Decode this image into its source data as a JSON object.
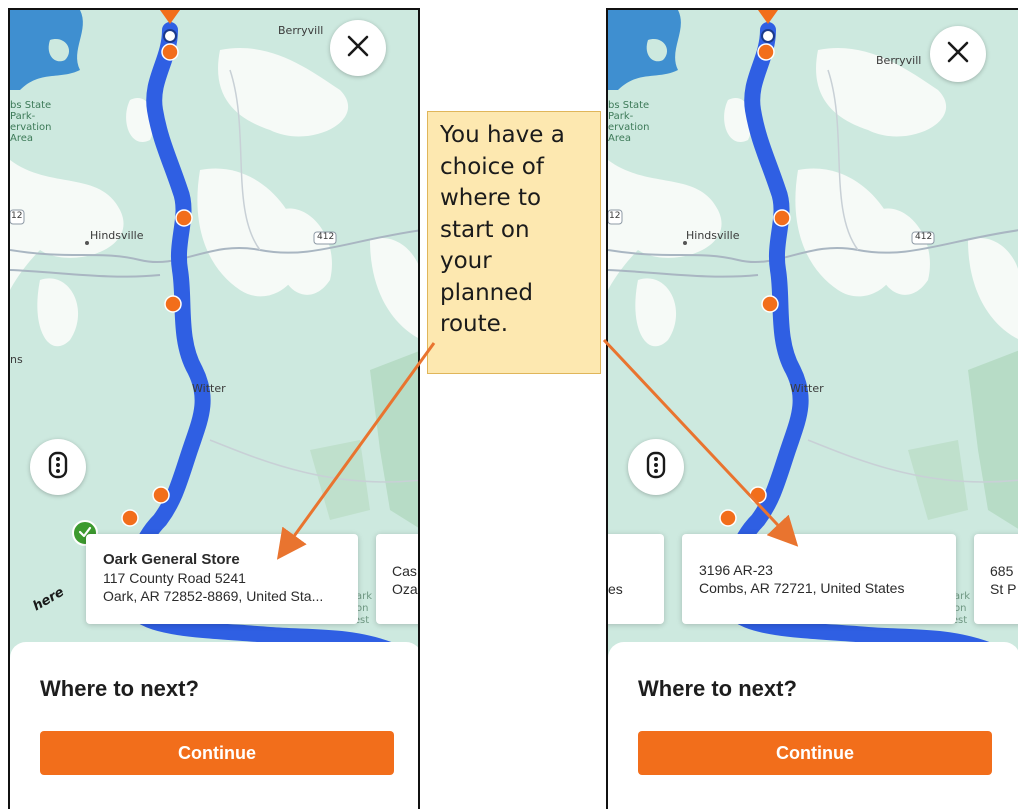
{
  "callout": {
    "text": "You have a choice of where to start on your planned route."
  },
  "left_phone": {
    "map_labels": {
      "berryville": "Berryvill",
      "park": "bs State Park- ervation Area",
      "hindsville": "Hindsville",
      "witter": "Witter",
      "hwy_412": "412",
      "hwy_12": "12",
      "ns": "ns",
      "ark": "ark",
      "on": "on",
      "rest": "rest"
    },
    "selected_card": {
      "name": "Oark General Store",
      "line1": "117 County Road 5241",
      "line2": "Oark, AR 72852-8869, United Sta..."
    },
    "next_card": {
      "line1": "Cas",
      "line2": "Oza"
    },
    "logo": "here",
    "sheet_title": "Where to next?",
    "continue_label": "Continue"
  },
  "right_phone": {
    "map_labels": {
      "berryville": "Berryvill",
      "park": "bs State Park- ervation Area",
      "hindsville": "Hindsville",
      "witter": "Witter",
      "hwy_412": "412",
      "hwy_12": "12",
      "ark": "ark",
      "on": "on",
      "rest": "rest"
    },
    "prev_card": {
      "line1": "es"
    },
    "current_card": {
      "line1": "3196 AR-23",
      "line2": "Combs, AR 72721, United States"
    },
    "next_card": {
      "line1": "685",
      "line2": "St P"
    },
    "sheet_title": "Where to next?",
    "continue_label": "Continue"
  },
  "icons": {
    "close": "close-icon",
    "traffic": "traffic-light-icon",
    "check": "check-icon",
    "waypoint": "waypoint-marker-icon",
    "start": "start-marker-icon"
  },
  "colors": {
    "route": "#2f5fe3",
    "waypoint": "#f26e1b",
    "continue": "#f26e1b",
    "water": "#3f8fd0",
    "map_bg": "#cde9df",
    "callout_bg": "#fde8b0",
    "arrow": "#e9742f",
    "check": "#3d9a2f"
  }
}
